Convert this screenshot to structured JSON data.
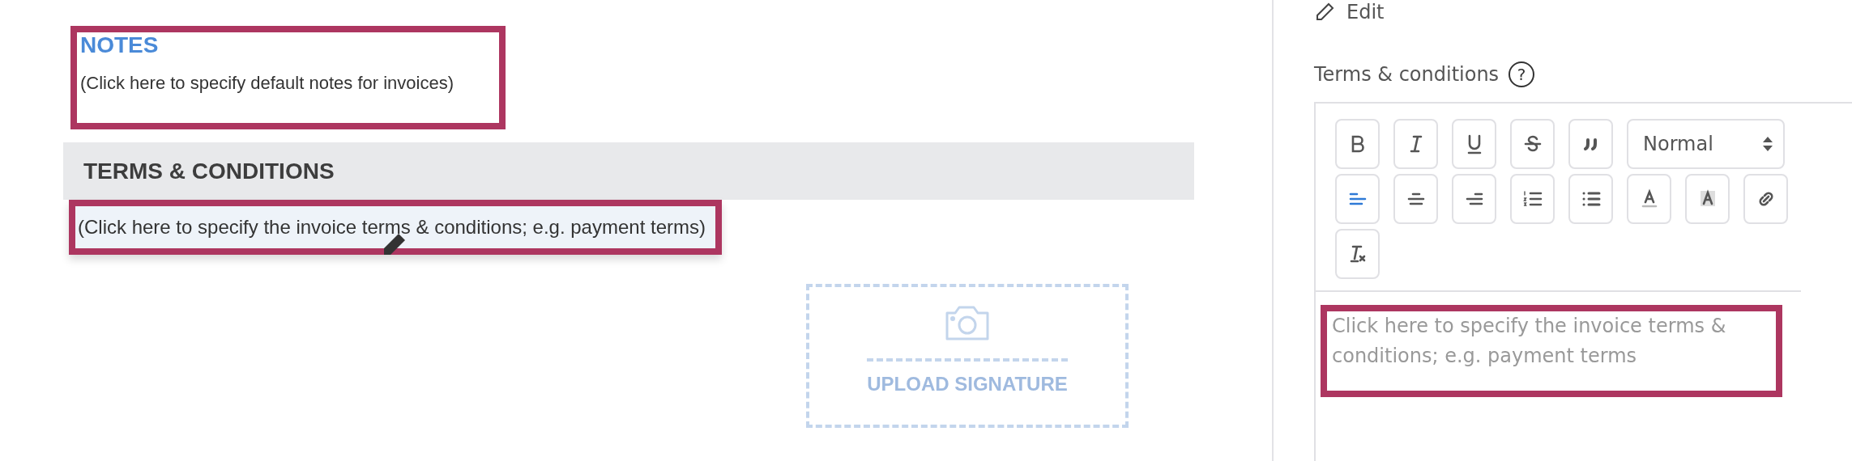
{
  "notes": {
    "heading": "NOTES",
    "text": "(Click here to specify default notes for invoices)",
    "highlighted": true
  },
  "terms": {
    "heading": "TERMS & CONDITIONS",
    "text": "(Click here to specify the invoice terms & conditions; e.g. payment terms)",
    "highlighted": true
  },
  "signature": {
    "label": "UPLOAD SIGNATURE"
  },
  "panel": {
    "edit": "Edit",
    "label": "Terms & conditions",
    "help": "?",
    "toolbar": [
      {
        "kind": "bold",
        "selected": false
      },
      {
        "kind": "italic",
        "selected": false
      },
      {
        "kind": "underline",
        "selected": false
      },
      {
        "kind": "strike",
        "selected": false
      },
      {
        "kind": "blockquote",
        "selected": false
      },
      {
        "kind": "select",
        "value": "Normal"
      },
      {
        "kind": "align-left",
        "selected": true
      },
      {
        "kind": "align-center",
        "selected": false
      },
      {
        "kind": "align-right",
        "selected": false
      },
      {
        "kind": "ordered-list",
        "selected": false
      },
      {
        "kind": "bullet-list",
        "selected": false
      },
      {
        "kind": "text-color",
        "selected": false
      },
      {
        "kind": "background",
        "selected": false
      },
      {
        "kind": "link",
        "selected": false
      },
      {
        "kind": "clean",
        "selected": false
      }
    ],
    "editor": {
      "placeholder": "Click here to specify the invoice terms & conditions; e.g. payment terms",
      "highlighted": true
    }
  }
}
